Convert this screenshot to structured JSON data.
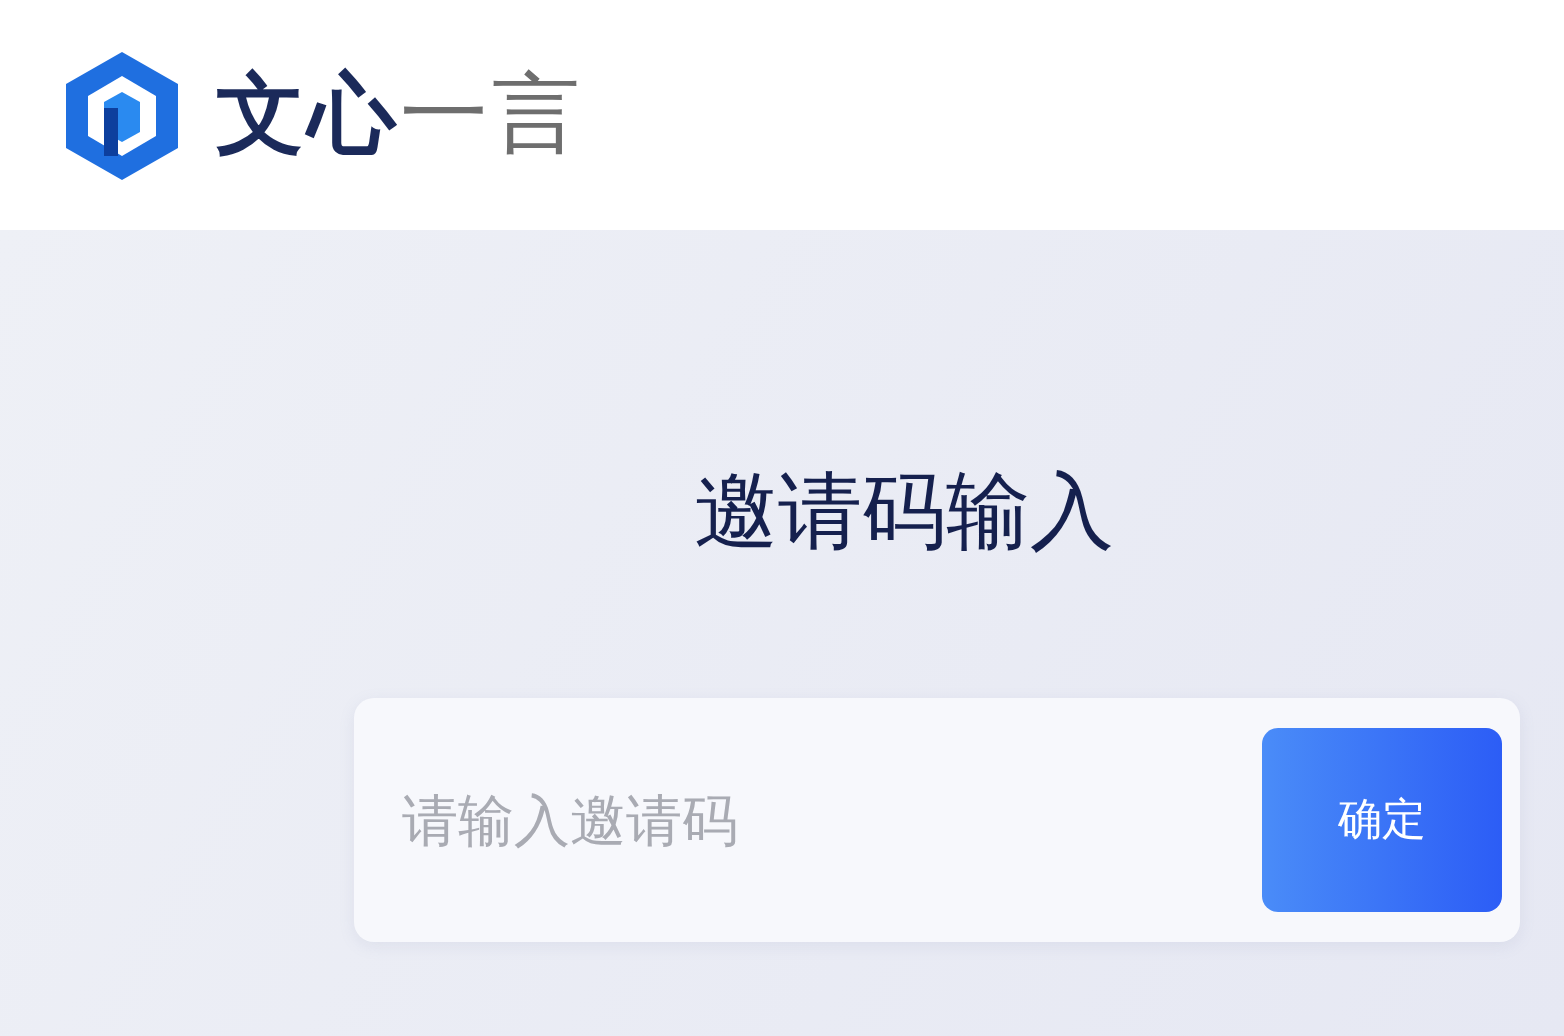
{
  "header": {
    "logo_text": "文心一言"
  },
  "invite": {
    "title": "邀请码输入",
    "placeholder": "请输入邀请码",
    "button": "确定"
  }
}
